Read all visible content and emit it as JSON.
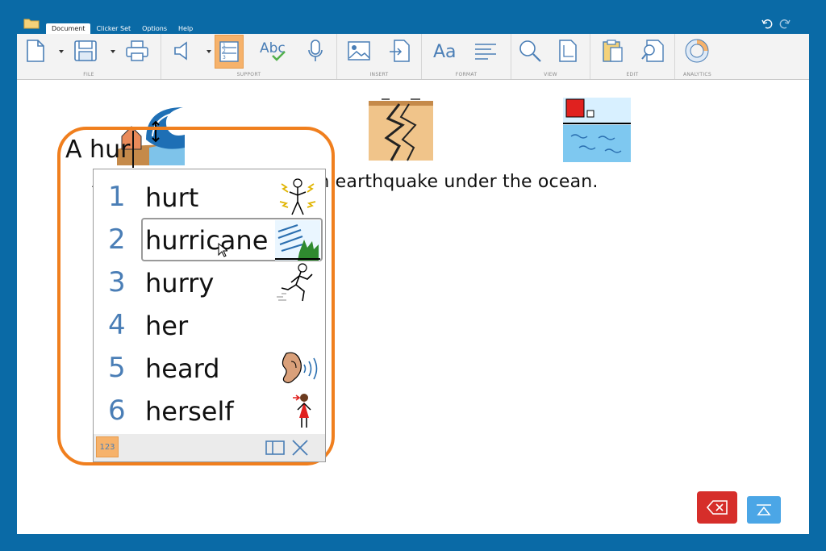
{
  "menu": {
    "tabs": [
      {
        "label": "Document",
        "active": true
      },
      {
        "label": "Clicker Set",
        "active": false
      },
      {
        "label": "Options",
        "active": false
      },
      {
        "label": "Help",
        "active": false
      }
    ]
  },
  "ribbon": {
    "groups": [
      {
        "label": "FILE"
      },
      {
        "label": "SUPPORT"
      },
      {
        "label": "INSERT"
      },
      {
        "label": "FORMAT"
      },
      {
        "label": "VIEW"
      },
      {
        "label": "EDIT"
      },
      {
        "label": "ANALYTICS"
      }
    ],
    "spell_label": "Abc",
    "font_label": "Aa"
  },
  "document": {
    "sentence": "A tsunami is caused by an earthquake under the  ocean.",
    "typed_text": "A hur"
  },
  "prediction": {
    "items": [
      {
        "number": "1",
        "word": "hurt",
        "icon": "hurt-symbol-icon"
      },
      {
        "number": "2",
        "word": "hurricane",
        "icon": "hurricane-symbol-icon",
        "selected": true
      },
      {
        "number": "3",
        "word": "hurry",
        "icon": "hurry-symbol-icon"
      },
      {
        "number": "4",
        "word": "her",
        "icon": ""
      },
      {
        "number": "5",
        "word": "heard",
        "icon": "heard-symbol-icon"
      },
      {
        "number": "6",
        "word": "herself",
        "icon": "herself-symbol-icon"
      }
    ],
    "numbers_button_label": "123"
  },
  "colors": {
    "background": "#0a6aa6",
    "highlight": "#f07f1e",
    "active_button": "#f6b26b",
    "number_blue": "#4a7eb6",
    "delete_red": "#d62e2a",
    "keyboard_blue": "#4ba6e6"
  }
}
